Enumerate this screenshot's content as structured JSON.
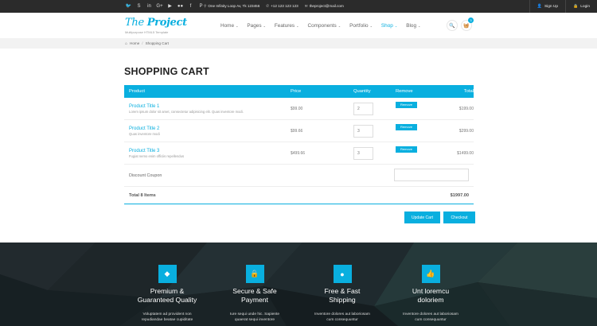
{
  "topbar": {
    "social_icons": [
      "twitter-icon",
      "skype-icon",
      "linkedin-icon",
      "googleplus-icon",
      "youtube-icon",
      "flickr-icon",
      "facebook-icon",
      "pinterest-icon"
    ],
    "address": "One Infinity Loop Av, Tk 123456",
    "phone": "+12 123 123 123",
    "email": "theproject@mail.com",
    "signup_label": "Sign Up",
    "login_label": "Login"
  },
  "header": {
    "logo_first": "The",
    "logo_second": "Project",
    "tagline": "Multipurpose HTML5 Template",
    "nav": [
      {
        "label": "Home",
        "active": false
      },
      {
        "label": "Pages",
        "active": false
      },
      {
        "label": "Features",
        "active": false
      },
      {
        "label": "Components",
        "active": false
      },
      {
        "label": "Portfolio",
        "active": false
      },
      {
        "label": "Shop",
        "active": true
      },
      {
        "label": "Blog",
        "active": false
      }
    ],
    "cart_count": "3"
  },
  "breadcrumb": {
    "home": "Home",
    "current": "Shopping Cart"
  },
  "page": {
    "title": "SHOPPING CART"
  },
  "cart": {
    "headers": {
      "product": "Product",
      "price": "Price",
      "quantity": "Quantity",
      "remove": "Remove",
      "total": "Total"
    },
    "items": [
      {
        "title": "Product Title 1",
        "desc": "Lorem ipsum dolor sit amet, consectetur adipisicing elit. Quas inventore modi.",
        "price": "$99.00",
        "qty": "2",
        "remove": "Remove",
        "total": "$199.00"
      },
      {
        "title": "Product Title 2",
        "desc": "Quas inventore modi",
        "price": "$99.66",
        "qty": "3",
        "remove": "Remove",
        "total": "$299.00"
      },
      {
        "title": "Product Title 3",
        "desc": "Fugiat nemo enim officiis repellendus",
        "price": "$499.66",
        "qty": "3",
        "remove": "Remove",
        "total": "$1499.00"
      }
    ],
    "coupon_label": "Discount Coupon",
    "total_label": "Total 8 Items",
    "total_amount": "$1997.00",
    "update_label": "Update Cart",
    "checkout_label": "Checkout"
  },
  "features": [
    {
      "icon": "diamond-icon",
      "title_1": "Premium &",
      "title_2": "Guaranteed Quality",
      "desc_1": "Voluptatem ad provident non",
      "desc_2": "repudiandae beatae cupiditate"
    },
    {
      "icon": "lock-icon",
      "title_1": "Secure & Safe",
      "title_2": "Payment",
      "desc_1": "Iure sequi unde hic. Sapiente",
      "desc_2": "quaerat sequi inventore"
    },
    {
      "icon": "globe-icon",
      "title_1": "Free & Fast",
      "title_2": "Shipping",
      "desc_1": "Inventore dolores aut laboriosam",
      "desc_2": "cum consequuntur"
    },
    {
      "icon": "thumbs-up-icon",
      "title_1": "Unt loremcu",
      "title_2": "doloriem",
      "desc_1": "Inventore dolores aut laboriosam",
      "desc_2": "cum consequuntur"
    }
  ],
  "colors": {
    "accent": "#09afdf",
    "topbar_bg": "#2b2b2b",
    "footer_bg": "#1b2124"
  }
}
